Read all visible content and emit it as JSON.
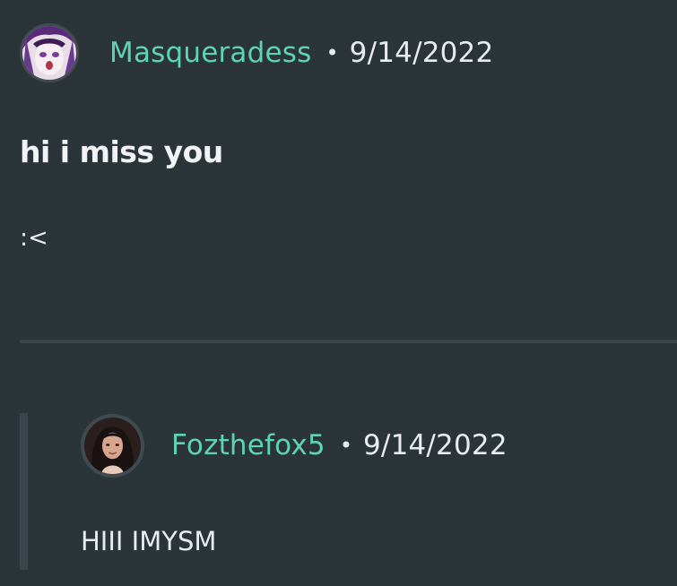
{
  "post": {
    "author": "Masqueradess",
    "separator": "•",
    "date": "9/14/2022",
    "avatar_icon": "anime-avatar-icon",
    "title": "hi i miss you",
    "body": ":<"
  },
  "reply": {
    "author": "Fozthefox5",
    "separator": "•",
    "date": "9/14/2022",
    "avatar_icon": "photo-avatar-icon",
    "body": "HIII IMYSM"
  },
  "colors": {
    "background": "#2a3439",
    "username": "#5fd3b5",
    "text": "#e9ecee",
    "divider": "#3a464c"
  }
}
